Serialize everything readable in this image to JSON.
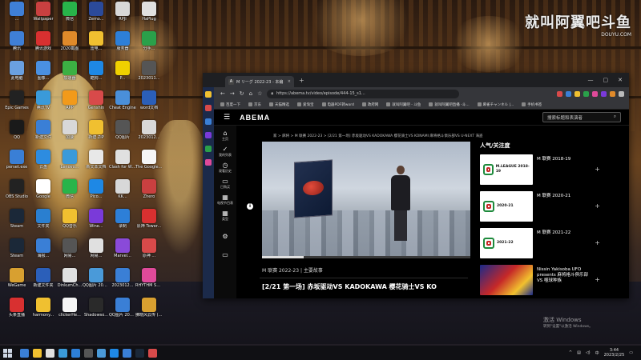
{
  "watermark": {
    "brand": "就叫阿翼吧",
    "logo": "斗鱼",
    "sub": "DOUYU.COM"
  },
  "desktop_icons": [
    {
      "label": "...",
      "color": "#3f7fd6",
      "col": 0,
      "row": 0
    },
    {
      "label": "Wallpaper",
      "color": "#c94040",
      "col": 1,
      "row": 0
    },
    {
      "label": "微信",
      "color": "#28b44a",
      "col": 2,
      "row": 0
    },
    {
      "label": "Zemo...",
      "color": "#2b4a9a",
      "col": 3,
      "row": 0
    },
    {
      "label": "RPJI",
      "color": "#d8d8d8",
      "col": 4,
      "row": 0
    },
    {
      "label": "HaPlug",
      "color": "#e0e0e0",
      "col": 5,
      "row": 0
    },
    {
      "label": "腾讯",
      "color": "#3f7fd6",
      "col": 0,
      "row": 1
    },
    {
      "label": "腾讯游戏",
      "color": "#d83030",
      "col": 1,
      "row": 1
    },
    {
      "label": "2020截图",
      "color": "#e08a2a",
      "col": 2,
      "row": 1
    },
    {
      "label": "雷电...",
      "color": "#f0c030",
      "col": 3,
      "row": 1
    },
    {
      "label": "服务器",
      "color": "#2d7fd8",
      "col": 4,
      "row": 1
    },
    {
      "label": "分手...",
      "color": "#2aa04a",
      "col": 5,
      "row": 1
    },
    {
      "label": "此电脑",
      "color": "#6aa0e0",
      "col": 0,
      "row": 2
    },
    {
      "label": "图像...",
      "color": "#4a90e2",
      "col": 1,
      "row": 2
    },
    {
      "label": "加速器",
      "color": "#3cb043",
      "col": 2,
      "row": 2
    },
    {
      "label": "酷狗...",
      "color": "#1e88e5",
      "col": 3,
      "row": 2
    },
    {
      "label": "P...",
      "color": "#f0d000",
      "col": 4,
      "row": 2
    },
    {
      "label": "2023011...",
      "color": "#555555",
      "col": 5,
      "row": 2
    },
    {
      "label": "Epic Games",
      "color": "#222222",
      "col": 0,
      "row": 3
    },
    {
      "label": "腾讯TV",
      "color": "#3a9ad9",
      "col": 1,
      "row": 3
    },
    {
      "label": "APP",
      "color": "#f29a1a",
      "col": 2,
      "row": 3
    },
    {
      "label": "Genshin",
      "color": "#d84a4a",
      "col": 3,
      "row": 3
    },
    {
      "label": "Cheat Engine",
      "color": "#4a8fd9",
      "col": 4,
      "row": 3
    },
    {
      "label": "word文档",
      "color": "#2b5fb9",
      "col": 5,
      "row": 3
    },
    {
      "label": "QQ",
      "color": "#1a1a1a",
      "col": 0,
      "row": 4
    },
    {
      "label": "新建文件",
      "color": "#3a7fd6",
      "col": 1,
      "row": 4
    },
    {
      "label": "加速",
      "color": "#d8d8d8",
      "col": 2,
      "row": 4
    },
    {
      "label": "新建.ZIP",
      "color": "#f0c030",
      "col": 3,
      "row": 4
    },
    {
      "label": "QQ图片",
      "color": "#555555",
      "col": 4,
      "row": 4
    },
    {
      "label": "2023012...",
      "color": "#d8d8d8",
      "col": 5,
      "row": 4
    },
    {
      "label": "perset.exe",
      "color": "#3a7fd6",
      "col": 0,
      "row": 5
    },
    {
      "label": "云盘",
      "color": "#2d8ce0",
      "col": 1,
      "row": 5
    },
    {
      "label": "Lenovo...",
      "color": "#3a9ad9",
      "col": 2,
      "row": 5
    },
    {
      "label": "新文本文档",
      "color": "#e8e8e8",
      "col": 3,
      "row": 5
    },
    {
      "label": "Clash for Windows",
      "color": "#e0e0e0",
      "col": 4,
      "row": 5
    },
    {
      "label": "The Google Clicker",
      "color": "#f5f5f5",
      "col": 5,
      "row": 5
    },
    {
      "label": "OBS Studio",
      "color": "#222222",
      "col": 0,
      "row": 6
    },
    {
      "label": "Google",
      "color": "#ffffff",
      "col": 1,
      "row": 6
    },
    {
      "label": "微信",
      "color": "#28b44a",
      "col": 2,
      "row": 6
    },
    {
      "label": "Pico...",
      "color": "#1e88e5",
      "col": 3,
      "row": 6
    },
    {
      "label": "KK...",
      "color": "#d8d8d8",
      "col": 4,
      "row": 6
    },
    {
      "label": "Zhero",
      "color": "#c94040",
      "col": 5,
      "row": 6
    },
    {
      "label": "Steam",
      "color": "#1b2838",
      "col": 0,
      "row": 7
    },
    {
      "label": "文件夹",
      "color": "#2a7fd0",
      "col": 1,
      "row": 7
    },
    {
      "label": "QQ音乐",
      "color": "#f0c030",
      "col": 2,
      "row": 7
    },
    {
      "label": "Wine...",
      "color": "#7a3ad9",
      "col": 3,
      "row": 7
    },
    {
      "label": "录制",
      "color": "#2d7fd8",
      "col": 4,
      "row": 7
    },
    {
      "label": "原神 Tower...",
      "color": "#d83030",
      "col": 5,
      "row": 7
    },
    {
      "label": "Steam",
      "color": "#1b2838",
      "col": 0,
      "row": 8
    },
    {
      "label": "海报...",
      "color": "#3a7fd6",
      "col": 1,
      "row": 8
    },
    {
      "label": "网易...",
      "color": "#555555",
      "col": 2,
      "row": 8
    },
    {
      "label": "网易...",
      "color": "#e0e0e0",
      "col": 3,
      "row": 8
    },
    {
      "label": "Marvel...",
      "color": "#8a4ad9",
      "col": 4,
      "row": 8
    },
    {
      "label": "原神 ...",
      "color": "#d84a4a",
      "col": 5,
      "row": 8
    },
    {
      "label": "WeGame",
      "color": "#d8a030",
      "col": 0,
      "row": 9
    },
    {
      "label": "新建文件夹",
      "color": "#2b5fb9",
      "col": 1,
      "row": 9
    },
    {
      "label": "DinkumCh...",
      "color": "#e0e0e0",
      "col": 2,
      "row": 9
    },
    {
      "label": "QQ图片 2023012...",
      "color": "#4a9ad9",
      "col": 3,
      "row": 9
    },
    {
      "label": "2023012...",
      "color": "#3a7fd6",
      "col": 4,
      "row": 9
    },
    {
      "label": "RHYTHM SPROUT",
      "color": "#e04a9a",
      "col": 5,
      "row": 9
    },
    {
      "label": "头条直播",
      "color": "#d83030",
      "col": 0,
      "row": 10
    },
    {
      "label": "harmony...",
      "color": "#f0c030",
      "col": 1,
      "row": 10
    },
    {
      "label": "clickerHe...",
      "color": "#f5f5f5",
      "col": 2,
      "row": 10
    },
    {
      "label": "Shadowso...",
      "color": "#2a2a2a",
      "col": 3,
      "row": 10
    },
    {
      "label": "QQ图片 2023012...",
      "color": "#3a7fd6",
      "col": 4,
      "row": 10
    },
    {
      "label": "拂晓风云传 (Tale of ...",
      "color": "#d8a030",
      "col": 5,
      "row": 10
    }
  ],
  "browser": {
    "tab_title": "M リーグ 2022-23 - 本编",
    "tab_favicon": "A",
    "url": "https://abema.tv/video/episode/444-15_s1...",
    "bookmarks": [
      "百度一下",
      "京东",
      "天猫精选",
      "爱淘宝",
      "电器PDF转word",
      "政府网",
      "就叫阿翼吧 - 斗鱼",
      "就叫阿翼吧直播 -斗...",
      "麻雀チャンネル |...",
      "手机书签"
    ]
  },
  "abema": {
    "logo": "ABEMA",
    "search_placeholder": "搜索标题和表演者",
    "nav": [
      {
        "label": "主页",
        "icon": "⌂"
      },
      {
        "label": "我的列表",
        "icon": "✓"
      },
      {
        "label": "观看历史",
        "icon": "◷"
      },
      {
        "label": "已购买",
        "icon": "▭"
      },
      {
        "label": "电视节目表",
        "icon": "▦"
      },
      {
        "label": "类型",
        "icon": "▦"
      }
    ],
    "breadcrumb": "家 > 麻将 > M 联赛 2022-23 > [2/21 第一场] 赤坂驱动VS KADOKAWA 樱花骑士VS KONAMI 麻将格斗俱乐部VS U-NEXT 海盗",
    "episode_subtitle": "M 联赛 2022-23 | 主要故事",
    "episode_title": "[2/21 第一场] 赤坂驱动VS KADOKAWA 樱花骑士VS KO",
    "progress_fraction": 0.2,
    "related_header": "人气/关注度",
    "related": [
      {
        "title": "M 联赛 2018-19",
        "thumb_text": "M.LEAGUE 2018-19",
        "poster": false
      },
      {
        "title": "M 联赛 2020-21",
        "thumb_text": "2020-21",
        "poster": false
      },
      {
        "title": "M 联赛 2021-22",
        "thumb_text": "2021-22",
        "poster": false
      },
      {
        "title": "Nissin Yakisoba UFO presents 麻将格斗俱乐部 VS 噬球种族",
        "thumb_text": "",
        "poster": true
      }
    ]
  },
  "activate_windows": {
    "title": "激活 Windows",
    "sub": "转到\"设置\"以激活 Windows。"
  },
  "taskbar": {
    "time": "3:44",
    "date": "2023/2/25",
    "ime": "中",
    "apps": [
      "#3a7fd6",
      "#f0c030",
      "#e0e0e0",
      "#3a9ad9",
      "#2d7fd8",
      "#555555",
      "#4a9ad9",
      "#1e88e5",
      "#3a7fd6",
      "#1b2838",
      "#d84a4a"
    ]
  }
}
